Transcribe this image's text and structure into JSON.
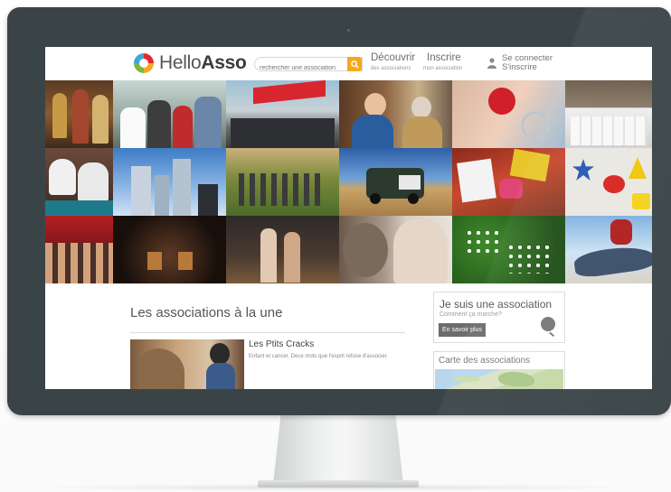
{
  "site": {
    "logo_prefix": "Hello",
    "logo_suffix": "Asso"
  },
  "header": {
    "search_placeholder": "rechercher une association",
    "discover_label": "Découvrir",
    "discover_sub": "des associations",
    "register_label": "Inscrire",
    "register_sub": "mon association",
    "login_label": "Se connecter",
    "signup_label": "S'inscrire"
  },
  "featured": {
    "section_title": "Les associations à la une",
    "items": [
      {
        "title": "Les Ptits Cracks",
        "description": "Enfant et cancer. Deux mots que l'esprit refuse d'associer."
      }
    ]
  },
  "sidebar": {
    "association_box": {
      "title": "Je suis une association",
      "subtitle": "Comment ça marche?",
      "button": "En savoir plus"
    },
    "map_box": {
      "title": "Carte des associations"
    }
  },
  "colors": {
    "accent": "#f6a821",
    "bezel": "#3a4447",
    "button": "#6c6c6c"
  },
  "icons": [
    "search-icon",
    "user-icon",
    "lightbulb-icon",
    "logo-icon"
  ]
}
